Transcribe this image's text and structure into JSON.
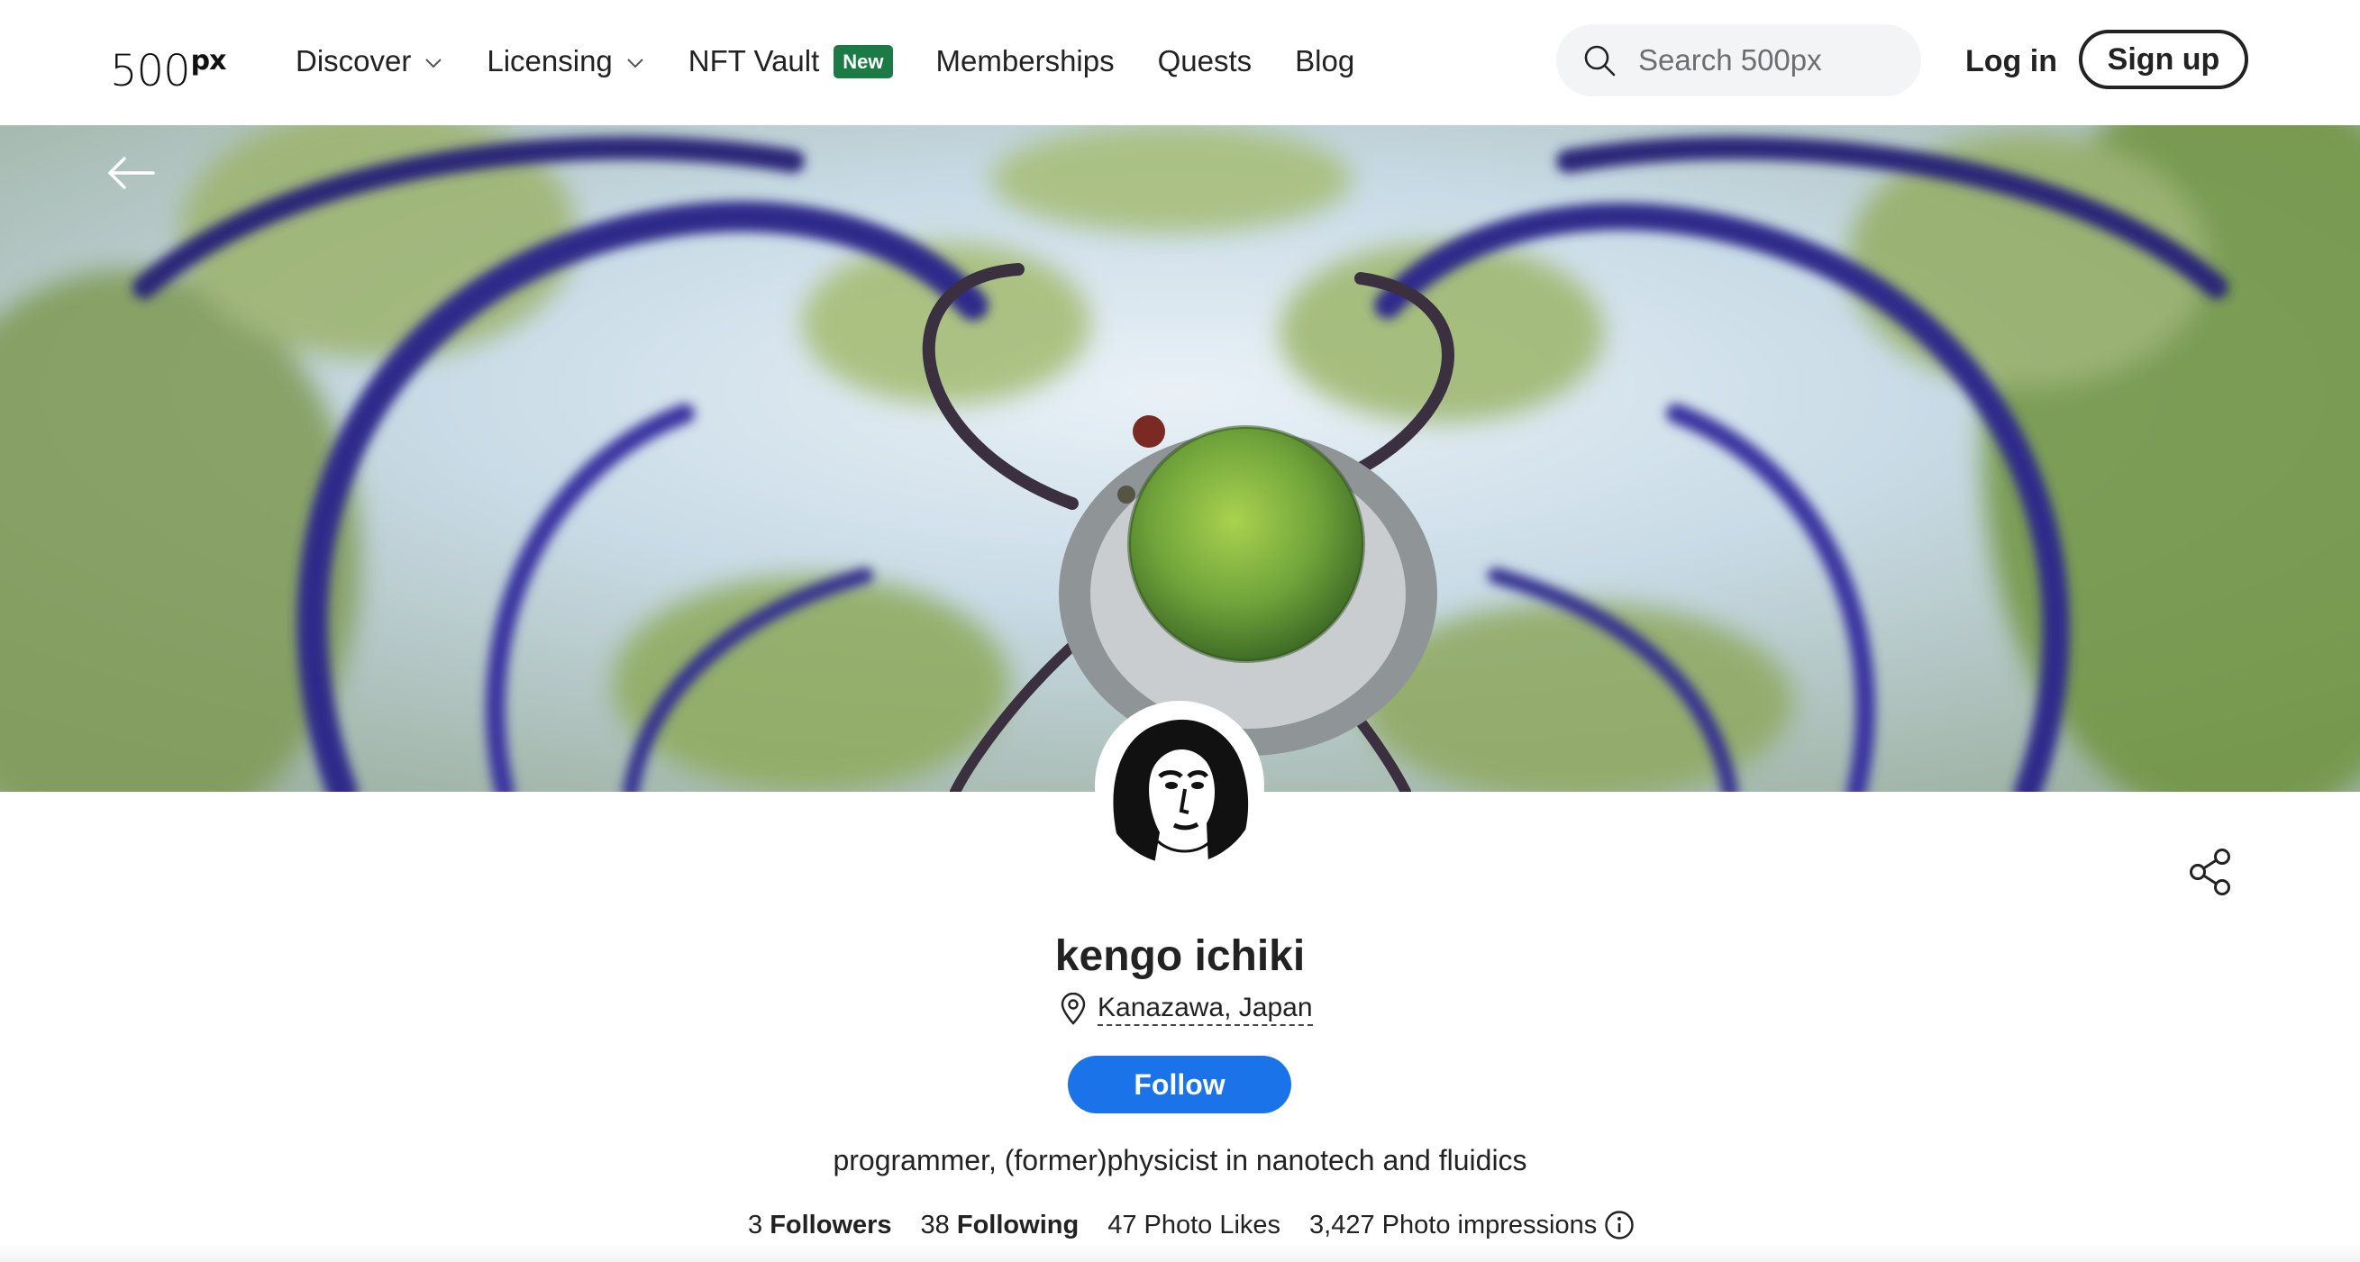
{
  "header": {
    "logo": "500",
    "logo_sup": "px",
    "nav": [
      {
        "label": "Discover",
        "has_dropdown": true
      },
      {
        "label": "Licensing",
        "has_dropdown": true
      },
      {
        "label": "NFT Vault",
        "badge": "New"
      },
      {
        "label": "Memberships"
      },
      {
        "label": "Quests"
      },
      {
        "label": "Blog"
      }
    ],
    "search_placeholder": "Search 500px",
    "login_label": "Log in",
    "signup_label": "Sign up"
  },
  "cover": {
    "back_icon": "arrow-left-icon"
  },
  "profile": {
    "name": "kengo ichiki",
    "location": "Kanazawa, Japan",
    "follow_label": "Follow",
    "bio": "programmer, (former)physicist in nanotech and fluidics",
    "stats": {
      "followers_count": "3",
      "followers_label": "Followers",
      "following_count": "38",
      "following_label": "Following",
      "photo_likes": "47 Photo Likes",
      "photo_impressions": "3,427 Photo impressions"
    }
  },
  "colors": {
    "accent": "#1a73e8",
    "badge": "#1b7a45",
    "text": "#222222"
  }
}
